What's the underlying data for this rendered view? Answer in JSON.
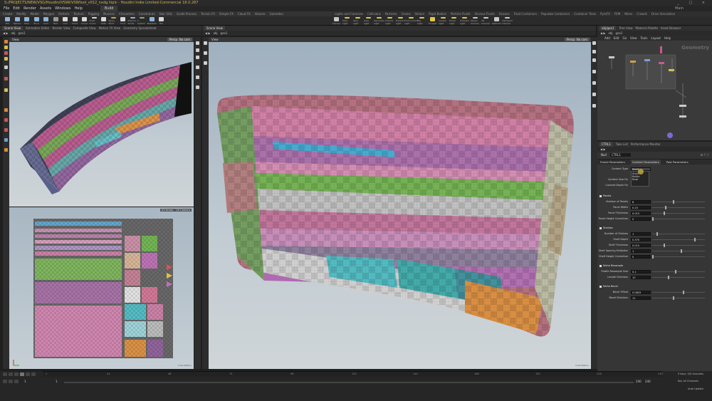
{
  "window": {
    "title": "S:/PROJECTS/NEW/VSG/Houdini/VSWI/VSWtool_v012_nxdg.hiplc - Houdini Indie Limited-Commercial 18.0.287",
    "controls": "_ □ ×"
  },
  "menu": {
    "items": [
      "File",
      "Edit",
      "Render",
      "Assets",
      "Windows",
      "Help"
    ],
    "build": "Build",
    "desktop": "Main"
  },
  "shelf_tabs_left": [
    "Create",
    "Modify",
    "Model",
    "Polygon",
    "Deform",
    "Texture",
    "Rigging",
    "Muscles",
    "Characters",
    "Constraints",
    "Hair Utils",
    "Guide Process",
    "Terrain FX",
    "Simple FX",
    "Cloud FX",
    "Volume",
    "Gamedev"
  ],
  "shelf_tabs_right": [
    "Lights and Cameras",
    "Collisions",
    "Particles",
    "Grains",
    "Vellum",
    "Rigid Bodies",
    "Particle Fluids",
    "Viscous Fluids",
    "Oceans",
    "Fluid Containers",
    "Populate Containers",
    "Container Tools",
    "PyroFX",
    "FEM",
    "Wires",
    "Crowds",
    "Drive Simulation"
  ],
  "shelf_tools_left": [
    {
      "label": "Box",
      "color": "#8fb4d8"
    },
    {
      "label": "Sphere",
      "color": "#8fb4d8"
    },
    {
      "label": "Tube",
      "color": "#8fb4d8"
    },
    {
      "label": "Torus",
      "color": "#8fb4d8"
    },
    {
      "label": "Grid",
      "color": "#8fb4d8"
    },
    {
      "label": "Null",
      "color": "#9a9a9a"
    },
    {
      "label": "Line",
      "color": "#d8d8d8"
    },
    {
      "label": "Circle",
      "color": "#d8d8d8"
    },
    {
      "label": "Curve",
      "color": "#d8d8d8"
    },
    {
      "label": "Draw Curve",
      "color": "#d8d8d8"
    },
    {
      "label": "Path",
      "color": "#d8d8d8"
    },
    {
      "label": "Spray Paint",
      "color": "#c9a24b"
    },
    {
      "label": "Font",
      "color": "#d8d8d8"
    },
    {
      "label": "Platonic Solids",
      "color": "#8fb4d8"
    },
    {
      "label": "L-System",
      "color": "#7fb06a"
    },
    {
      "label": "Metaball",
      "color": "#8fb4d8"
    },
    {
      "label": "File",
      "color": "#d8d8d8"
    }
  ],
  "shelf_tools_right": [
    {
      "label": "Camera",
      "color": "#c8c8c8"
    },
    {
      "label": "Point Light",
      "color": "#e3c84b"
    },
    {
      "label": "Spot Light",
      "color": "#e3c84b"
    },
    {
      "label": "Area Light",
      "color": "#e3c84b"
    },
    {
      "label": "Geometry Light",
      "color": "#e3c84b"
    },
    {
      "label": "Volume Light",
      "color": "#e3c84b"
    },
    {
      "label": "Distant Light",
      "color": "#e3c84b"
    },
    {
      "label": "Environment Light",
      "color": "#e3c84b"
    },
    {
      "label": "Sky Light",
      "color": "#e3c84b"
    },
    {
      "label": "GI Light",
      "color": "#e3c84b"
    },
    {
      "label": "Caustic Light",
      "color": "#e3c84b"
    },
    {
      "label": "Portal Light",
      "color": "#e3c84b"
    },
    {
      "label": "Ambient Light",
      "color": "#e3c84b"
    },
    {
      "label": "Stereo Camera",
      "color": "#c8c8c8"
    },
    {
      "label": "VR Camera",
      "color": "#c8c8c8"
    },
    {
      "label": "Switcher",
      "color": "#c8c8c8"
    },
    {
      "label": "Gamepad Camera",
      "color": "#c8c8c8"
    }
  ],
  "left_panel": {
    "tabs": [
      "Scene View",
      "Animation Editor",
      "Render View",
      "Composite View",
      "Motion FX View",
      "Geometry Spreadsheet"
    ],
    "path": [
      "obj",
      "geo1"
    ],
    "view_label": "View",
    "camera": "Persp",
    "cam_menu": "No cam",
    "uv_label_1": "UV Arrow",
    "uv_label_2": "UV Camera",
    "corner_note": "Indie Edition"
  },
  "center_panel": {
    "tabs": [
      "Scene View"
    ],
    "path": [
      "obj",
      "geo1"
    ],
    "view_label": "View",
    "camera": "Persp",
    "cam_menu": "No cam",
    "watermark": "Indie Edition"
  },
  "right_network": {
    "tabs": [
      "obj/geo1",
      "Tree View",
      "Material Palette",
      "Asset Browser"
    ],
    "path": [
      "obj",
      "geo1"
    ],
    "menu": [
      "Add",
      "Edit",
      "Go",
      "View",
      "Tools",
      "Layout",
      "Help"
    ],
    "context_label": "Geometry"
  },
  "parameters": {
    "tabs": [
      "CTRL1",
      "Take List",
      "Performance Monitor"
    ],
    "node_type": "Null",
    "node_name": "CTRL1",
    "sub_tabs": [
      "Frame Parameters",
      "Content Parameters",
      "Post Parameters"
    ],
    "content_type_label": "Content Type",
    "content_type_value": "Shelf",
    "content_type_options": [
      "Shelf",
      "Bottle",
      "Bowl"
    ],
    "content_size_label": "Content Size Fix",
    "content_depth_label": "Content Depth Fix",
    "folders": [
      {
        "title": "Panels",
        "rows": [
          {
            "label": "Number of Panels",
            "value": "8",
            "knob": 0.4
          },
          {
            "label": "Panel Width",
            "value": "0.15",
            "knob": 0.25
          },
          {
            "label": "Panel Thickness",
            "value": "0.015",
            "knob": 0.22
          },
          {
            "label": "Panel Height Correction",
            "value": "0",
            "knob": 0.0
          }
        ]
      },
      {
        "title": "Shelves",
        "rows": [
          {
            "label": "Number of Shelves",
            "value": "1",
            "knob": 0.08
          },
          {
            "label": "Shelf Depth",
            "value": "0.375",
            "knob": 0.82
          },
          {
            "label": "Shelf Thickness",
            "value": "0.015",
            "knob": 0.22
          },
          {
            "label": "Shelf Spacing Multiplier",
            "value": "1",
            "knob": 0.55
          },
          {
            "label": "Shelf Height Correction",
            "value": "0",
            "knob": 0.0
          }
        ]
      },
      {
        "title": "Niche Resample",
        "rows": [
          {
            "label": "Profile Resample Size",
            "value": "0.1",
            "knob": 0.45
          },
          {
            "label": "Length Divisions",
            "value": "10",
            "knob": 0.3
          }
        ]
      },
      {
        "title": "Niche Bevel",
        "rows": [
          {
            "label": "Bevel Offset",
            "value": "0.0825",
            "knob": 0.6
          },
          {
            "label": "Bevel Divisions",
            "value": "12",
            "knob": 0.4
          }
        ]
      }
    ]
  },
  "timeline": {
    "ticks": [
      "1",
      "24",
      "48",
      "72",
      "96",
      "120",
      "144",
      "168",
      "192",
      "216",
      "240"
    ],
    "frame_start": "1",
    "frame_end": "240",
    "frame_end2": "240",
    "current": "1",
    "keys_info": "0 keys, 0/0 channels",
    "key_all": "Key All Channels",
    "auto_update": "Auto Update"
  }
}
